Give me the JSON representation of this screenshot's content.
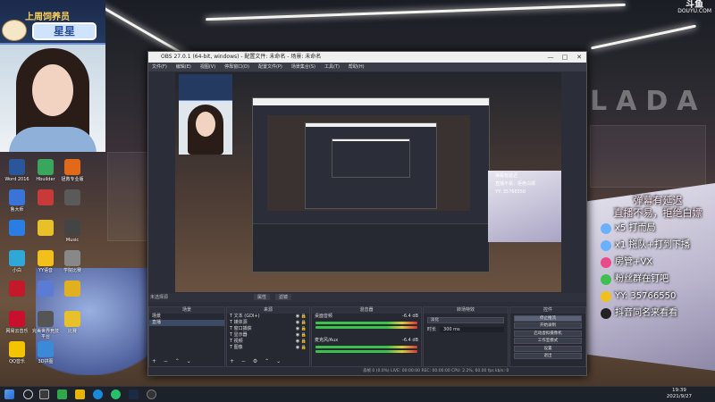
{
  "badge": {
    "title": "上周饲养员",
    "name": "星星"
  },
  "douyu": {
    "big": "斗鱼",
    "small": "DOUYU.COM"
  },
  "brand_wall": "LADA",
  "desktop_icons": [
    {
      "label": "Word 2016",
      "color": "#2b579a"
    },
    {
      "label": "Hbuilder",
      "color": "#3aa55d"
    },
    {
      "label": "拯救专业版",
      "color": "#e06a1a"
    },
    {
      "label": "鲁大师",
      "color": "#3a74d9"
    },
    {
      "label": "",
      "color": "#c83a3a"
    },
    {
      "label": "",
      "color": "#5a5a5a"
    },
    {
      "label": "",
      "color": "#2a7de1"
    },
    {
      "label": "",
      "color": "#e8c02a"
    },
    {
      "label": "Music",
      "color": "#444"
    },
    {
      "label": "小白",
      "color": "#2fa8d8"
    },
    {
      "label": "YY语音",
      "color": "#f2c01c"
    },
    {
      "label": "学院比赛",
      "color": "#888"
    },
    {
      "label": "",
      "color": "#c21a2a"
    },
    {
      "label": "",
      "color": "#5b7bd4"
    },
    {
      "label": "",
      "color": "#e0b020"
    },
    {
      "label": "网易云音乐",
      "color": "#c8102e"
    },
    {
      "label": "完美世界竞技平台",
      "color": "#555"
    },
    {
      "label": "比赛",
      "color": "#e8c02a"
    },
    {
      "label": "QQ音乐",
      "color": "#f5c400"
    },
    {
      "label": "3D拼图",
      "color": "#3a8ad8"
    }
  ],
  "stream_text": {
    "header1": "弹幕有延迟",
    "header2": "直播不易，拒绝白嫖",
    "rows": [
      {
        "text": "x5 打而局",
        "color": "#6ab0ff"
      },
      {
        "text": "x1 拖队+打到下播",
        "color": "#6ab0ff"
      },
      {
        "text": "房管+VX",
        "color": "#e84a8a"
      },
      {
        "text": "粉丝群在钉吧",
        "color": "#3fbf4f"
      },
      {
        "text": "YY: 35766550",
        "color": "#f2c01c"
      },
      {
        "text": "抖音同名来看看",
        "color": "#222"
      }
    ]
  },
  "obs": {
    "title": "OBS 27.0.1 (64-bit, windows) - 配置文件: 未命名 - 场景: 未命名",
    "menu": [
      "文件(F)",
      "编辑(E)",
      "视图(V)",
      "停靠窗口(D)",
      "配置文件(P)",
      "场景集合(S)",
      "工具(T)",
      "帮助(H)"
    ],
    "window_buttons": [
      "—",
      "□",
      "✕"
    ],
    "preview_label": "未选择源",
    "filters_btn": "属性",
    "filters_btn2": "滤镜",
    "docks": {
      "scenes": {
        "title": "场景",
        "items": [
          "场景",
          "直播"
        ]
      },
      "sources": {
        "title": "来源",
        "items": [
          "文本 (GDI+)",
          "媒体源",
          "窗口捕获",
          "显示器",
          "视频",
          "图像"
        ]
      },
      "mixer": {
        "title": "混音器",
        "tracks": [
          "桌面音频",
          "麦克风/Aux"
        ],
        "db": "-6.4 dB"
      },
      "transitions": {
        "title": "转场特效",
        "type": "淡化",
        "duration_label": "时长",
        "duration": "300 ms"
      },
      "controls": {
        "title": "控件",
        "buttons": [
          "停止推流",
          "开始录制",
          "启动虚拟摄像机",
          "工作室模式",
          "设置",
          "退出"
        ]
      }
    },
    "status": "丢帧 0 (0.0%)   LIVE: 00:00:00   REC: 00:00:00   CPU: 2.2%, 60.00 fps   kb/s: 0"
  },
  "taskbar": {
    "time": "19:39",
    "date": "2021/9/27"
  }
}
